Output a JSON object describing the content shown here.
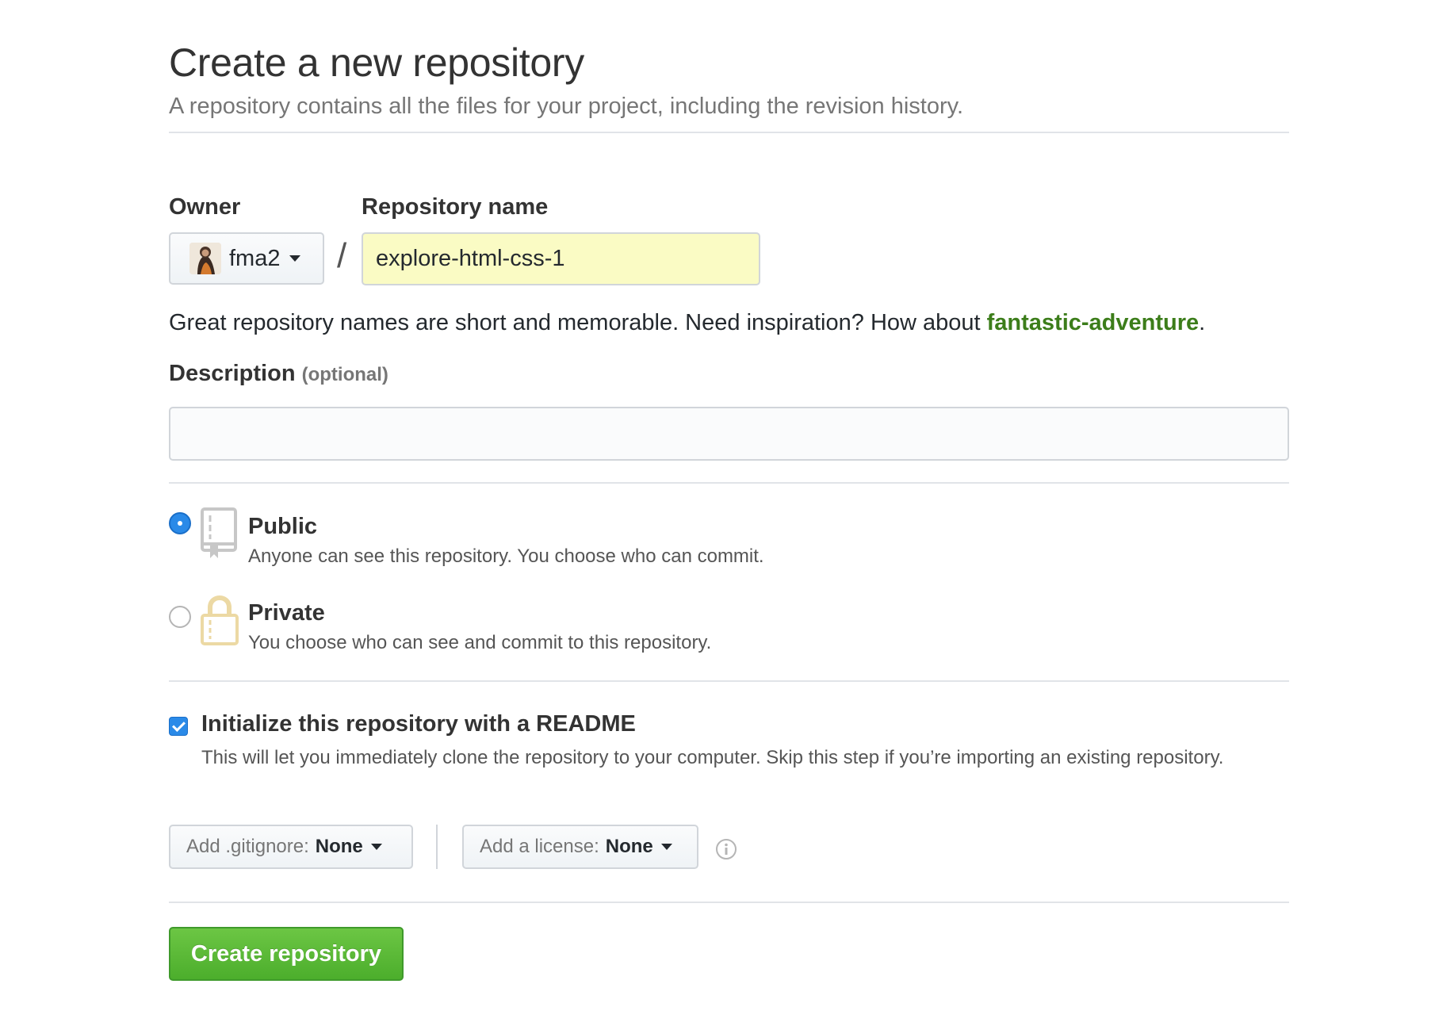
{
  "header": {
    "title": "Create a new repository",
    "subtitle": "A repository contains all the files for your project, including the revision history."
  },
  "owner": {
    "label": "Owner",
    "value": "fma2",
    "avatar_icon": "user-avatar"
  },
  "repo": {
    "label": "Repository name",
    "separator": "/",
    "value": "explore-html-css-1"
  },
  "hint": {
    "text": "Great repository names are short and memorable. Need inspiration? How about ",
    "suggestion": "fantastic-adventure",
    "end": "."
  },
  "description": {
    "label": "Description",
    "optional": "(optional)",
    "value": "",
    "placeholder": ""
  },
  "visibility": {
    "selected": "public",
    "public": {
      "title": "Public",
      "desc": "Anyone can see this repository. You choose who can commit.",
      "icon": "repo-book-icon"
    },
    "private": {
      "title": "Private",
      "desc": "You choose who can see and commit to this repository.",
      "icon": "lock-icon"
    }
  },
  "readme": {
    "checked": true,
    "title": "Initialize this repository with a README",
    "desc": "This will let you immediately clone the repository to your computer. Skip this step if you’re importing an existing repository."
  },
  "gitignore": {
    "label": "Add .gitignore:",
    "value": "None"
  },
  "license": {
    "label": "Add a license:",
    "value": "None"
  },
  "info_icon": "info-icon",
  "submit": {
    "label": "Create repository"
  },
  "colors": {
    "accent_blue": "#2a8ae8",
    "suggestion_green": "#3c7d1a",
    "primary_button": "#5cb83a",
    "repo_input_bg": "#fafbc4"
  }
}
